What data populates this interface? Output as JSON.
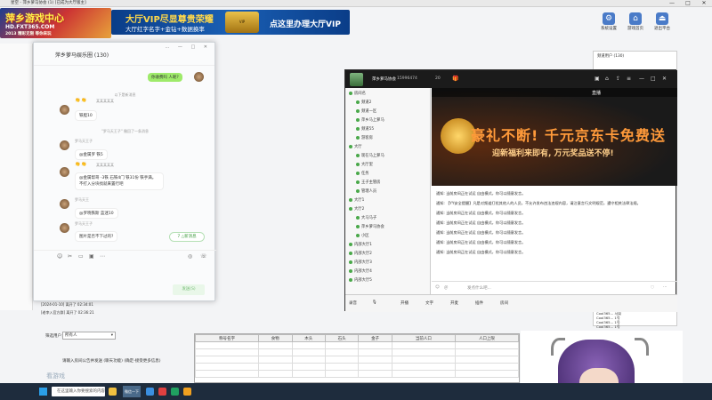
{
  "window": {
    "title": "星空 - 萍乡萝马协会 (1) [已成为大厅版主]",
    "minimize": "—",
    "maximize": "□",
    "close": "✕"
  },
  "header": {
    "logo_line1": "萍乡游戏中心",
    "logo_line2": "HD.FXT365.COM",
    "logo_line3": "2013 精彩无限  等你来玩",
    "banner_line1": "大厅VIP尽显尊贵荣耀",
    "banner_line2": "大厅红字名字+金钻+数据换率",
    "banner_line3": "点这里办理大厅VIP",
    "emblem": "VIP",
    "tools": [
      {
        "label": "系统设置",
        "icon": "gear-icon"
      },
      {
        "label": "游戏首页",
        "icon": "home-icon"
      },
      {
        "label": "退出平台",
        "icon": "exit-icon"
      }
    ]
  },
  "qq_chat": {
    "title": "萍乡萝马娱乐圈 (130)",
    "win_buttons": "… — □ ✕",
    "messages": [
      {
        "type": "me",
        "text": "你收费吗 人呢?"
      },
      {
        "type": "sys",
        "text": "以下是新消息"
      },
      {
        "type": "other",
        "nick": "某某某某某",
        "text": "铁胆10",
        "emoji": "👏👏"
      },
      {
        "type": "sys",
        "text": "\"罗马天王子\" 撤回了一条消息"
      },
      {
        "type": "other",
        "nick": "罗马天王子",
        "text": "@金属罗 铁5"
      },
      {
        "type": "other",
        "nick": "某某某某某",
        "text": "@金属帮哥 -3铁 石铁4门 铁31份 铁手满。 不打入分块找就来置行吧",
        "emoji": "👏👏"
      },
      {
        "type": "other",
        "nick": "罗马天王",
        "text": "@罗晓铁斯 蓝迷10"
      },
      {
        "type": "other",
        "nick": "罗马天王子",
        "text": "图片是否不下过的?"
      }
    ],
    "new_msg": "7 △新消息",
    "send": "发送(S)",
    "plus": "+"
  },
  "log": {
    "line1": "[2024-01-10] 离开了 02:34:01",
    "line2": "[老李入官方群] 离开了 02:36:21",
    "filter_label": "筛选用户：",
    "filter_value": "所有人",
    "notice": "请输入房间公告并发送 (聊天功能) (确定-接受更多信息)"
  },
  "sheet": {
    "headers": [
      "称号名字",
      "食物",
      "木头",
      "石头",
      "金子",
      "当前人口",
      "人口上限"
    ]
  },
  "taskbar": {
    "search": "在这里输入你要搜索的内容",
    "active": "微信一下",
    "watermark": "看游戏"
  },
  "yy": {
    "room": "萍乡萝马协会",
    "room_id": "15996474",
    "count": "20",
    "tree": [
      {
        "label": "房间名",
        "indent": 0
      },
      {
        "label": "频道2",
        "indent": 1
      },
      {
        "label": "频道一区",
        "indent": 1
      },
      {
        "label": "萍乡马上萝马",
        "indent": 1
      },
      {
        "label": "频道55",
        "indent": 1
      },
      {
        "label": "游客房",
        "indent": 1
      },
      {
        "label": "大厅",
        "indent": 0
      },
      {
        "label": "现在马上萝马",
        "indent": 1
      },
      {
        "label": "大厅里",
        "indent": 1
      },
      {
        "label": "任务",
        "indent": 1
      },
      {
        "label": "王子主管房",
        "indent": 1
      },
      {
        "label": "管理人员",
        "indent": 1
      },
      {
        "label": "大厅1",
        "indent": 0
      },
      {
        "label": "大厅2",
        "indent": 0
      },
      {
        "label": "大马马子",
        "indent": 1
      },
      {
        "label": "萍乡萝马协会",
        "indent": 1
      },
      {
        "label": "小区",
        "indent": 1
      },
      {
        "label": "内部大厅1",
        "indent": 0
      },
      {
        "label": "内部大厅2",
        "indent": 0
      },
      {
        "label": "内部大厅3",
        "indent": 0
      },
      {
        "label": "内部大厅4",
        "indent": 0
      },
      {
        "label": "内部大厅5",
        "indent": 0
      }
    ],
    "ad_headline": "豪礼不断! 千元京东卡免费送",
    "ad_sub": "迎新福利来即有, 万元奖品送不停!",
    "feed": [
      "通知: 当前房间正在试运 自由模式，你可以随意发言。",
      "通知: 【YY安全提醒】凡是对频道打扰其他人的人员，不允许发布违法违规内容，请注意言行文明规范，遵守相关法律法规。",
      "通知: 当前房间正在试运 自由模式，你可以随意发言。",
      "通知: 当前房间正在试运 自由模式，你可以随意发言。",
      "通知: 当前房间正在试运 自由模式，你可以随意发言。",
      "通知: 当前房间正在试运 自由模式，你可以随意发言。",
      "通知: 当前房间正在试运 自由模式，你可以随意发言。"
    ],
    "input_placeholder": "发点什么吧...",
    "bottom": [
      "录音",
      "开播",
      "文字",
      "开麦",
      "插件",
      "房间"
    ],
    "live_label": "直播",
    "right_title": "频道用户 (130)",
    "right_rows": [
      "Cool365...  马局",
      "Cool365...  1号",
      "Cool365...  1号",
      "Cool365...  1号",
      "Cool365...  2号"
    ]
  }
}
